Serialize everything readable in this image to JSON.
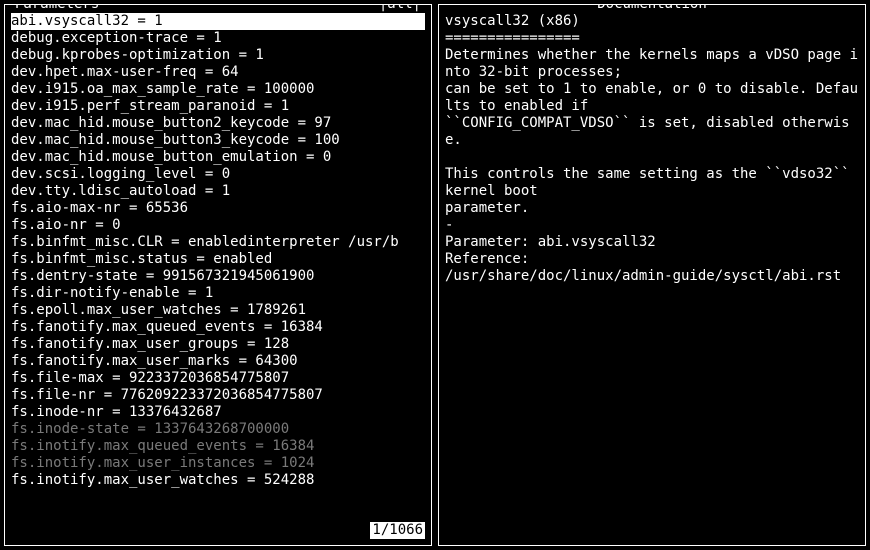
{
  "left": {
    "title": "Parameters",
    "filter_label": "|all|",
    "counter": "1/1066",
    "items": [
      {
        "text": "abi.vsyscall32 = 1",
        "selected": true
      },
      {
        "text": "debug.exception-trace = 1"
      },
      {
        "text": "debug.kprobes-optimization = 1"
      },
      {
        "text": "dev.hpet.max-user-freq = 64"
      },
      {
        "text": "dev.i915.oa_max_sample_rate = 100000"
      },
      {
        "text": "dev.i915.perf_stream_paranoid = 1"
      },
      {
        "text": "dev.mac_hid.mouse_button2_keycode = 97"
      },
      {
        "text": "dev.mac_hid.mouse_button3_keycode = 100"
      },
      {
        "text": "dev.mac_hid.mouse_button_emulation = 0"
      },
      {
        "text": "dev.scsi.logging_level = 0"
      },
      {
        "text": "dev.tty.ldisc_autoload = 1"
      },
      {
        "text": "fs.aio-max-nr = 65536"
      },
      {
        "text": "fs.aio-nr = 0"
      },
      {
        "text": "fs.binfmt_misc.CLR = enabledinterpreter /usr/b"
      },
      {
        "text": "fs.binfmt_misc.status = enabled"
      },
      {
        "text": "fs.dentry-state = 991567321945061900"
      },
      {
        "text": "fs.dir-notify-enable = 1"
      },
      {
        "text": "fs.epoll.max_user_watches = 1789261"
      },
      {
        "text": "fs.fanotify.max_queued_events = 16384"
      },
      {
        "text": "fs.fanotify.max_user_groups = 128"
      },
      {
        "text": "fs.fanotify.max_user_marks = 64300"
      },
      {
        "text": "fs.file-max = 9223372036854775807"
      },
      {
        "text": "fs.file-nr = 77620922337203685477580​7"
      },
      {
        "text": "fs.inode-nr = 13376432687"
      },
      {
        "text": "fs.inode-state = 1337643268700000",
        "dim": true
      },
      {
        "text": "fs.inotify.max_queued_events = 16384",
        "dim": true
      },
      {
        "text": "fs.inotify.max_user_instances = 1024",
        "dim": true
      },
      {
        "text": "fs.inotify.max_user_watches = 524288"
      }
    ]
  },
  "right": {
    "title": "Documentation",
    "body": "vsyscall32 (x86)\n================\nDetermines whether the kernels maps a vDSO page into 32-bit processes;\ncan be set to 1 to enable, or 0 to disable. Defaults to enabled if\n``CONFIG_COMPAT_VDSO`` is set, disabled otherwise.\n\nThis controls the same setting as the ``vdso32`` kernel boot\nparameter.\n-\nParameter: abi.vsyscall32\nReference:\n/usr/share/doc/linux/admin-guide/sysctl/abi.rst"
  }
}
